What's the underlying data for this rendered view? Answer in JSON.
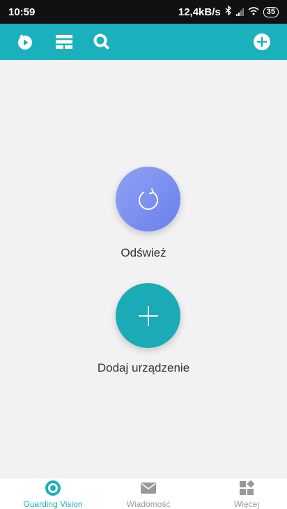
{
  "status_bar": {
    "time": "10:59",
    "speed": "12,4kB/s",
    "battery": "35"
  },
  "toolbar": {
    "icons": [
      "play-circle-icon",
      "list-icon",
      "search-icon",
      "add-circle-icon"
    ],
    "background_color": "#1bb1bc"
  },
  "main": {
    "refresh_label": "Odśwież",
    "add_device_label": "Dodaj urządzenie"
  },
  "bottom_nav": {
    "items": [
      {
        "label": "Guarding Vision",
        "icon": "eye-circle-icon",
        "active": true
      },
      {
        "label": "Wiadomość",
        "icon": "envelope-icon",
        "active": false
      },
      {
        "label": "Więcej",
        "icon": "grid-icon",
        "active": false
      }
    ],
    "active_color": "#1bb1bc",
    "inactive_color": "#999999"
  }
}
